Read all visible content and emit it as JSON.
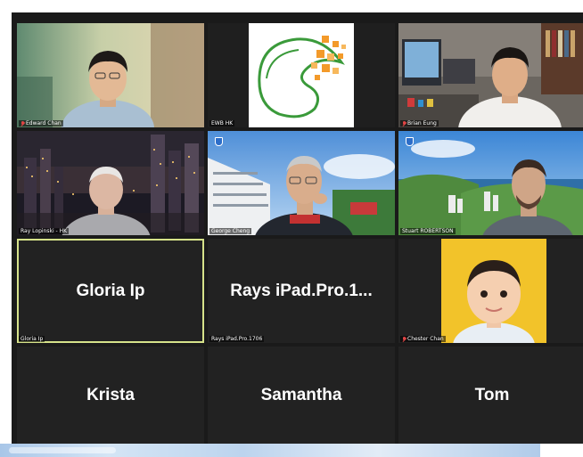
{
  "participants": [
    {
      "name": "Edward Chan",
      "muted": true
    },
    {
      "name": "EWB HK",
      "muted": false
    },
    {
      "name": "Brian Eung",
      "muted": true
    },
    {
      "name": "Ray Lopinski - HK",
      "muted": false
    },
    {
      "name": "George Cheng",
      "muted": false
    },
    {
      "name": "Stuart ROBERTSON",
      "muted": false
    },
    {
      "name": "Gloria Ip",
      "display": "Gloria Ip",
      "muted": false,
      "active_speaker": true
    },
    {
      "name": "Rays iPad.Pro.1706",
      "display": "Rays  iPad.Pro.1...",
      "muted": false
    },
    {
      "name": "Chester Chan",
      "muted": true
    },
    {
      "display": "Krista"
    },
    {
      "display": "Samantha"
    },
    {
      "display": "Tom"
    }
  ]
}
